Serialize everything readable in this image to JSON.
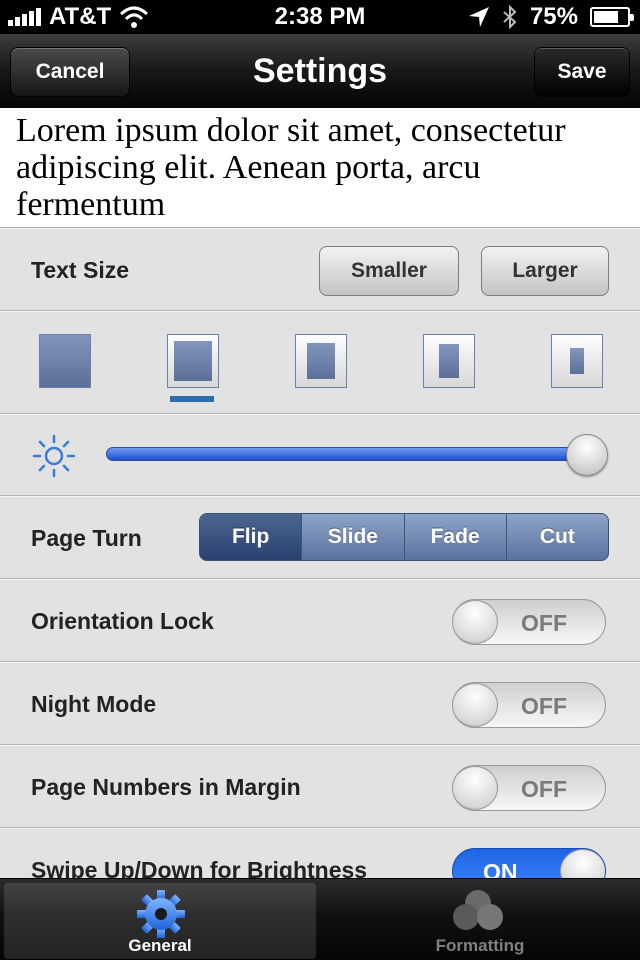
{
  "status_bar": {
    "carrier": "AT&T",
    "time": "2:38 PM",
    "battery": "75%",
    "battery_level": 0.75
  },
  "nav": {
    "title": "Settings",
    "cancel_label": "Cancel",
    "save_label": "Save"
  },
  "preview": {
    "text": "Lorem ipsum dolor sit amet, consectetur adipiscing elit. Aenean porta, arcu fermentum"
  },
  "text_size": {
    "label": "Text Size",
    "smaller_label": "Smaller",
    "larger_label": "Larger"
  },
  "margins": {
    "selected_index": 1,
    "option_count": 5
  },
  "brightness": {
    "value": 1.0
  },
  "page_turn": {
    "label": "Page Turn",
    "options": [
      "Flip",
      "Slide",
      "Fade",
      "Cut"
    ],
    "selected": "Flip"
  },
  "toggles": {
    "orientation_lock": {
      "label": "Orientation Lock",
      "state": "OFF"
    },
    "night_mode": {
      "label": "Night Mode",
      "state": "OFF"
    },
    "page_numbers": {
      "label": "Page Numbers in Margin",
      "state": "OFF"
    },
    "swipe_brightness": {
      "label": "Swipe Up/Down for Brightness",
      "state": "ON"
    }
  },
  "tabs": {
    "general": {
      "label": "General",
      "icon": "gear-icon",
      "active": true
    },
    "formatting": {
      "label": "Formatting",
      "icon": "circles-icon",
      "active": false
    }
  },
  "colors": {
    "accent_blue": "#2f6db0",
    "toggle_on": "#2f74f0",
    "segment_active": "#3a5280"
  }
}
